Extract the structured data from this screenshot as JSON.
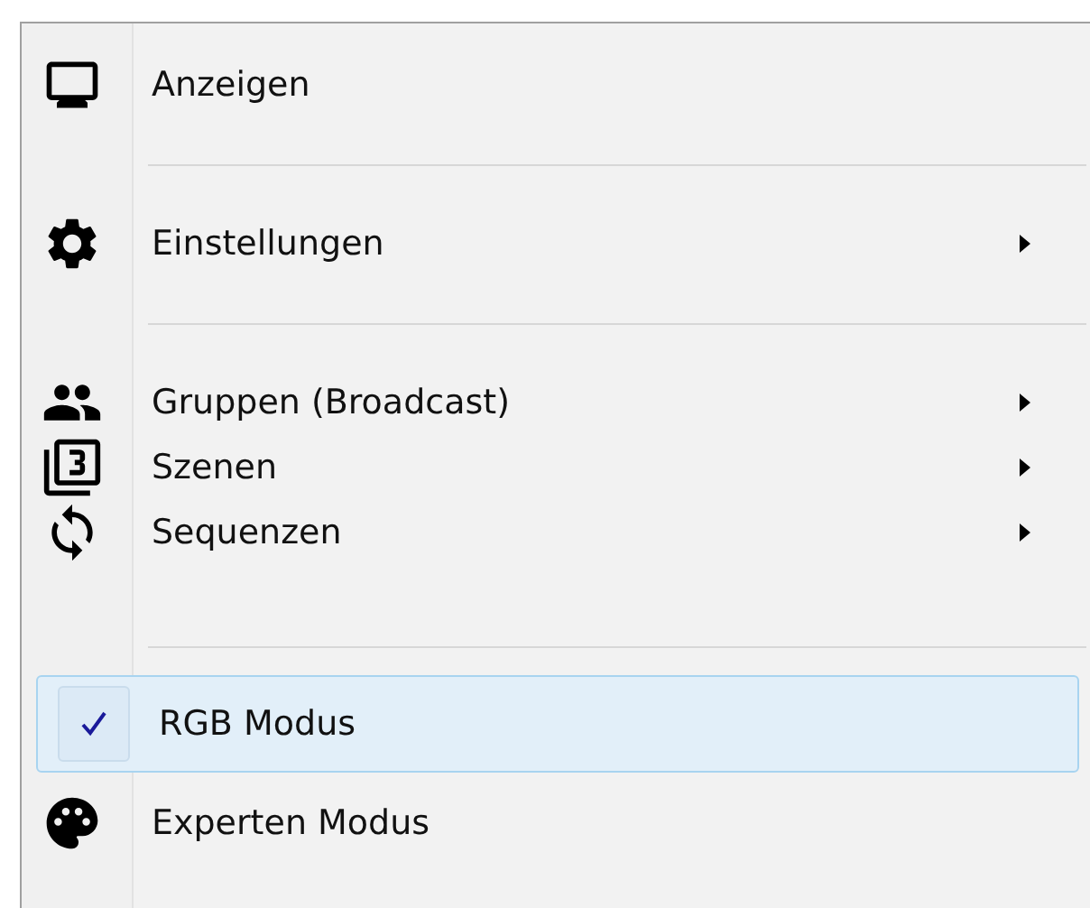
{
  "menu": {
    "items": [
      {
        "kind": "item",
        "label": "Anzeigen",
        "submenu": false,
        "checked": false,
        "selected": false
      },
      {
        "kind": "separator"
      },
      {
        "kind": "item",
        "label": "Einstellungen",
        "submenu": true,
        "checked": false,
        "selected": false
      },
      {
        "kind": "separator"
      },
      {
        "kind": "item",
        "label": "Gruppen (Broadcast)",
        "submenu": true,
        "checked": false,
        "selected": false
      },
      {
        "kind": "item",
        "label": "Szenen",
        "submenu": true,
        "checked": false,
        "selected": false
      },
      {
        "kind": "item",
        "label": "Sequenzen",
        "submenu": true,
        "checked": false,
        "selected": false
      },
      {
        "kind": "separator"
      },
      {
        "kind": "item",
        "label": "RGB Modus",
        "submenu": false,
        "checked": true,
        "selected": true
      },
      {
        "kind": "item",
        "label": "Experten Modus",
        "submenu": false,
        "checked": false,
        "selected": false
      }
    ]
  }
}
